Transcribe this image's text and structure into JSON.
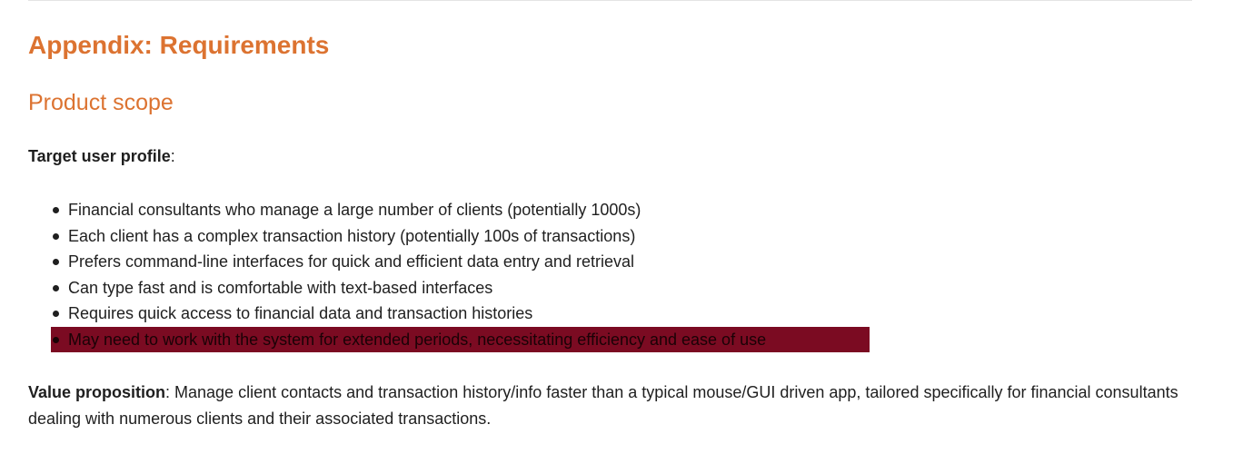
{
  "heading": "Appendix: Requirements",
  "subheading": "Product scope",
  "target_user": {
    "label": "Target user profile",
    "suffix": ":"
  },
  "bullets": [
    "Financial consultants who manage a large number of clients (potentially 1000s)",
    "Each client has a complex transaction history (potentially 100s of transactions)",
    "Prefers command-line interfaces for quick and efficient data entry and retrieval",
    "Can type fast and is comfortable with text-based interfaces",
    "Requires quick access to financial data and transaction histories",
    "May need to work with the system for extended periods, necessitating efficiency and ease of use"
  ],
  "value_proposition": {
    "label": "Value proposition",
    "text": ": Manage client contacts and transaction history/info faster than a typical mouse/GUI driven app, tailored specifically for financial consultants dealing with numerous clients and their associated transactions."
  },
  "colors": {
    "heading": "#dc7331",
    "highlight_background": "#7b0b22",
    "text": "#1f1f1f"
  }
}
